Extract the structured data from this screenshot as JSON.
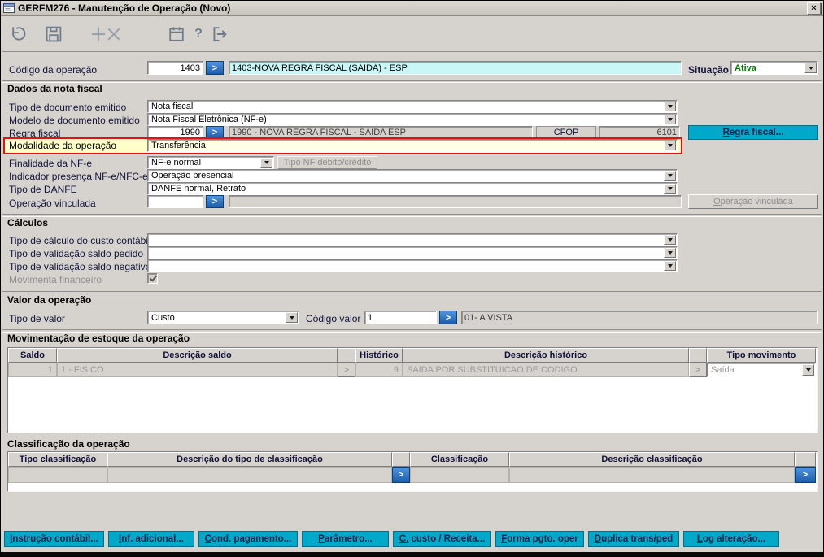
{
  "window": {
    "title": "GERFM276 - Manutenção de Operação (Novo)",
    "close_glyph": "×"
  },
  "toolbar": {
    "help_glyph": "?"
  },
  "glyphs": {
    "lookup": ">"
  },
  "colors": {
    "accent_cyan": "#00a8c9",
    "lookup_blue": "#1c5dab",
    "highlight_red": "#e11212",
    "highlight_yellow": "#ffffca",
    "status_green": "#007b00",
    "code_desc_cyan": "#c9f7f8"
  },
  "operacao": {
    "label": "Código da operação",
    "code": "1403",
    "descricao": "1403-NOVA REGRA FISCAL (SAIDA) - ESP",
    "situacao_label": "Situação",
    "situacao_value": "Ativa"
  },
  "dados_nota_fiscal": {
    "title": "Dados da nota fiscal",
    "tipo_documento_label": "Tipo de documento emitido",
    "tipo_documento_value": "Nota fiscal",
    "modelo_documento_label": "Modelo de documento emitido",
    "modelo_documento_value": "Nota Fiscal Eletrônica (NF-e)",
    "regra_fiscal_label": "Regra fiscal",
    "regra_fiscal_code": "1990",
    "regra_fiscal_descricao": "1990 - NOVA REGRA FISCAL - SAIDA ESP",
    "cfop_label": "CFOP",
    "cfop_value": "6101",
    "regra_fiscal_button": "Regra fiscal...",
    "modalidade_label": "Modalidade da operação",
    "modalidade_value": "Transferência",
    "finalidade_label": "Finalidade da NF-e",
    "finalidade_value": "NF-e normal",
    "tipo_nf_button": "Tipo NF débito/crédito",
    "indicador_label": "Indicador presença NF-e/NFC-e",
    "indicador_value": "Operação presencial",
    "danfe_label": "Tipo de DANFE",
    "danfe_value": "DANFE normal, Retrato",
    "operacao_vinculada_label": "Operação vinculada",
    "operacao_vinculada_code": "",
    "operacao_vinculada_descricao": "",
    "operacao_vinculada_button": "Operação vinculada"
  },
  "calculos": {
    "title": "Cálculos",
    "custo_contabil_label": "Tipo de cálculo do custo contábil",
    "custo_contabil_value": "",
    "saldo_pedido_label": "Tipo de validação saldo pedido",
    "saldo_pedido_value": "",
    "saldo_negativo_label": "Tipo de validação saldo negativo",
    "saldo_negativo_value": "",
    "movimenta_financeiro_label": "Movimenta financeiro",
    "movimenta_financeiro_checked": true
  },
  "valor_operacao": {
    "title": "Valor da operação",
    "tipo_valor_label": "Tipo de valor",
    "tipo_valor_value": "Custo",
    "codigo_valor_label": "Código valor",
    "codigo_valor": "1",
    "codigo_valor_descricao": "01- A VISTA"
  },
  "movimentacao_estoque": {
    "title": "Movimentação de estoque da operação",
    "headers": {
      "saldo": "Saldo",
      "descricao_saldo": "Descrição saldo",
      "historico": "Histórico",
      "descricao_historico": "Descrição histórico",
      "tipo_movimento": "Tipo movimento"
    },
    "row": {
      "saldo": "1",
      "descricao_saldo": "1 - FISICO",
      "historico": "9",
      "descricao_historico": "SAIDA POR SUBSTITUICAO DE CODIGO",
      "tipo_movimento": "Saída"
    }
  },
  "classificacao": {
    "title": "Classificação da operação",
    "headers": {
      "tipo": "Tipo classificação",
      "descricao_tipo": "Descrição do tipo de classificação",
      "classificacao": "Classificação",
      "descricao": "Descrição classificação"
    },
    "row": {
      "tipo": "",
      "descricao_tipo": "",
      "classificacao": "",
      "descricao": ""
    }
  },
  "footer_buttons": [
    "Instrução contábil...",
    "Inf. adicional...",
    "Cond. pagamento...",
    "Parâmetro...",
    "C. custo / Receita...",
    "Forma pgto. oper",
    "Duplica trans/ped",
    "Log alteração..."
  ]
}
